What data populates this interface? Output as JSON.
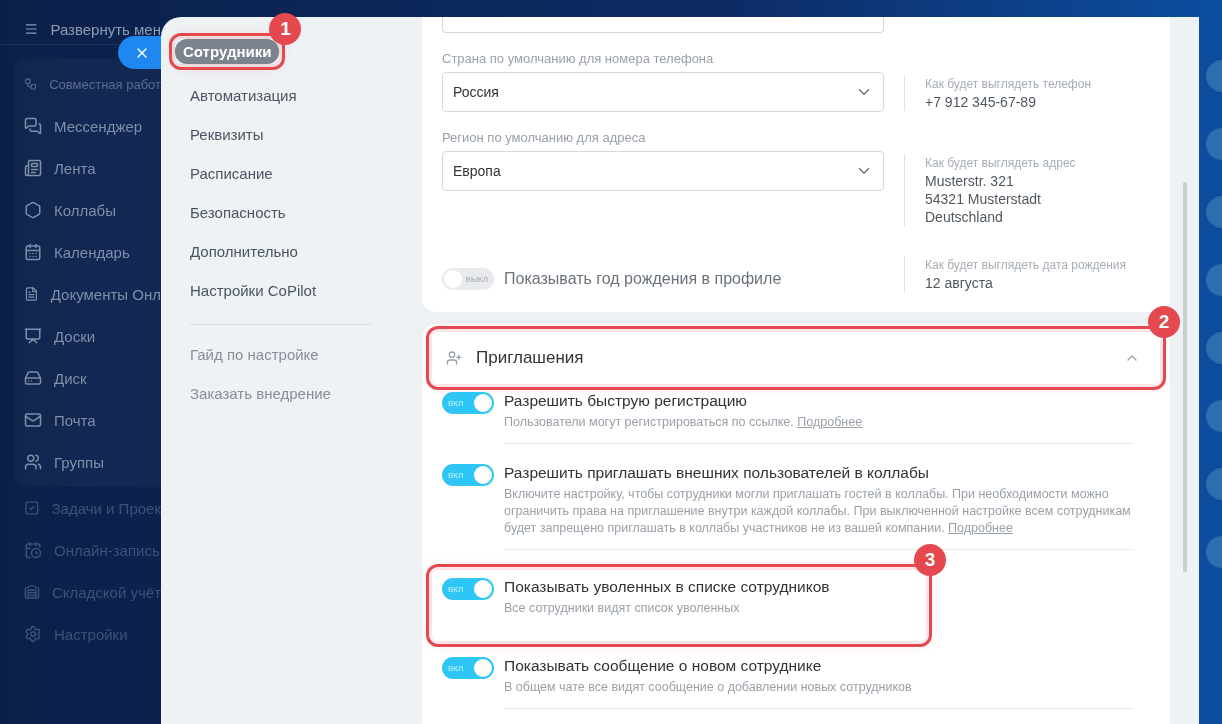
{
  "sidebar": {
    "expand_label": "Развернуть мен",
    "items": [
      {
        "label": "Совместная работ",
        "kind": "group"
      },
      {
        "label": "Мессенджер",
        "kind": "item"
      },
      {
        "label": "Лента",
        "kind": "item"
      },
      {
        "label": "Коллабы",
        "kind": "item"
      },
      {
        "label": "Календарь",
        "kind": "item"
      },
      {
        "label": "Документы Онл",
        "kind": "item"
      },
      {
        "label": "Доски",
        "kind": "item"
      },
      {
        "label": "Диск",
        "kind": "item"
      },
      {
        "label": "Почта",
        "kind": "item"
      },
      {
        "label": "Группы",
        "kind": "item"
      },
      {
        "label": "Задачи и Проек",
        "kind": "faded"
      },
      {
        "label": "Онлайн-запись",
        "kind": "faded"
      },
      {
        "label": "Складской учёт",
        "kind": "faded"
      },
      {
        "label": "Настройки",
        "kind": "faded"
      }
    ]
  },
  "settings_nav": {
    "items": [
      {
        "label": "Сотрудники",
        "selected": true,
        "marker": "1"
      },
      {
        "label": "Автоматизация",
        "selected": false
      },
      {
        "label": "Реквизиты",
        "selected": false
      },
      {
        "label": "Расписание",
        "selected": false
      },
      {
        "label": "Безопасность",
        "selected": false
      },
      {
        "label": "Дополнительно",
        "selected": false
      },
      {
        "label": "Настройки CoPilot",
        "selected": false
      }
    ],
    "links": [
      "Гайд по настройке",
      "Заказать внедрение"
    ]
  },
  "profile_card": {
    "selects": [
      {
        "label": "Страна по умолчанию для номера телефона",
        "value": "Россия",
        "preview_label": "Как будет выглядеть телефон",
        "preview_lines": [
          "+7 912 345-67-89"
        ]
      },
      {
        "label": "Регион по умолчанию для адреса",
        "value": "Европа",
        "preview_label": "Как будет выглядеть адрес",
        "preview_lines": [
          "Musterstr. 321",
          "54321 Musterstadt",
          "Deutschland"
        ]
      }
    ],
    "birthday": {
      "label": "Показывать год рождения в профиле",
      "on": false,
      "toggle_label": "ВЫКЛ",
      "preview_label": "Как будет выглядеть дата рождения",
      "preview_lines": [
        "12 августа"
      ]
    }
  },
  "invitations": {
    "title": "Приглашения",
    "expanded": true,
    "marker": "2",
    "settings": [
      {
        "title": "Разрешить быструю регистрацию",
        "on": true,
        "toggle_label": "ВКЛ",
        "description": "Пользователи могут регистрироваться по ссылке.",
        "link": "Подробнее"
      },
      {
        "title": "Разрешить приглашать внешних пользователей в коллабы",
        "on": true,
        "toggle_label": "ВКЛ",
        "description": "Включите настройку, чтобы сотрудники могли приглашать гостей в коллабы. При необходимости можно ограничить права на приглашение внутри каждой коллабы. При выключенной настройке всем сотрудникам будет запрещено приглашать в коллабы участников не из вашей компании.",
        "link": "Подробнее"
      },
      {
        "title": "Показывать уволенных в списке сотрудников",
        "on": true,
        "toggle_label": "ВКЛ",
        "description": "Все сотрудники видят список уволенных",
        "marker": "3"
      },
      {
        "title": "Показывать сообщение о новом сотруднике",
        "on": true,
        "toggle_label": "ВКЛ",
        "description": "В общем чате все видят сообщение о добавлении новых сотрудников"
      }
    ]
  }
}
